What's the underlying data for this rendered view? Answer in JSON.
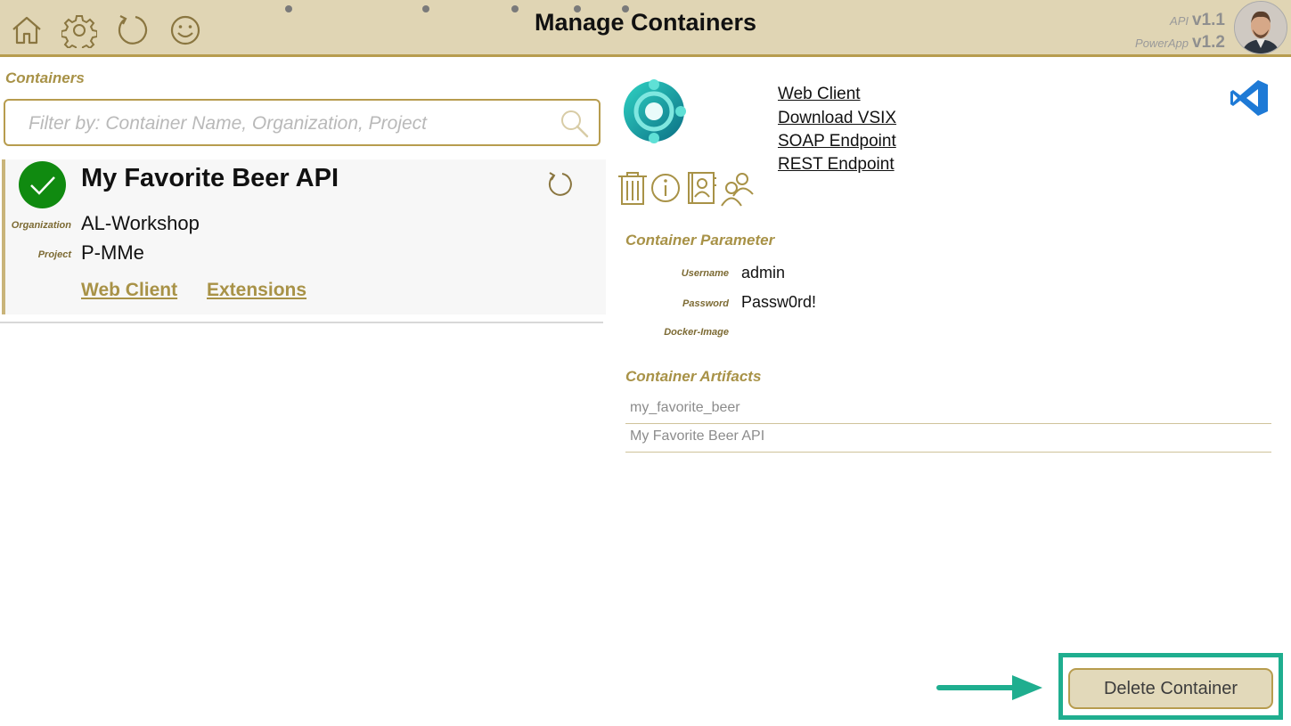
{
  "header": {
    "title": "Manage Containers",
    "icons": [
      "home-icon",
      "gear-icon",
      "refresh-icon",
      "smiley-icon"
    ],
    "api_label": "API",
    "api_version": "v1.1",
    "powerapp_label": "PowerApp",
    "powerapp_version": "v1.2",
    "bg_color": "#e0d5b4",
    "accent_color": "#b79c4e"
  },
  "containers": {
    "section_label": "Containers",
    "filter_placeholder": "Filter by: Container Name, Organization, Project",
    "filter_value": "",
    "items": [
      {
        "name": "My Favorite Beer API",
        "status": "running",
        "organization_label": "Organization",
        "organization": "AL-Workshop",
        "project_label": "Project",
        "project": "P-MMe",
        "links": [
          "Web Client",
          "Extensions"
        ]
      }
    ]
  },
  "details": {
    "links": [
      "Web Client",
      "Download VSIX",
      "SOAP Endpoint",
      "REST Endpoint"
    ],
    "action_icons": [
      "trash-icon",
      "info-icon",
      "contact-book-icon",
      "users-icon"
    ],
    "parameter_label": "Container Parameter",
    "parameters": [
      {
        "label": "Username",
        "value": "admin"
      },
      {
        "label": "Password",
        "value": "Passw0rd!"
      },
      {
        "label": "Docker-Image",
        "value": ""
      }
    ],
    "artifacts_label": "Container Artifacts",
    "artifacts": [
      "my_favorite_beer",
      "My Favorite Beer API"
    ]
  },
  "footer": {
    "delete_label": "Delete Container",
    "highlight_color": "#1fae8f"
  }
}
